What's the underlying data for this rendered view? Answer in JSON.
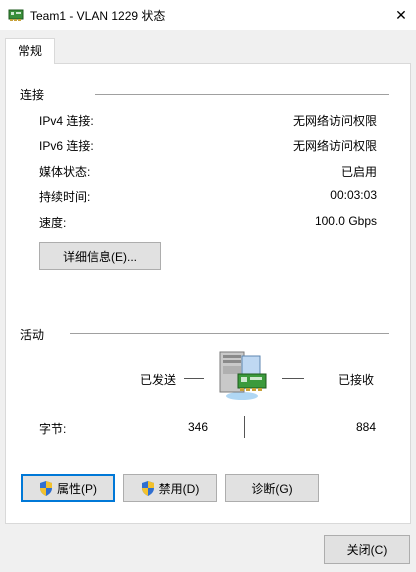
{
  "window": {
    "title": "Team1 - VLAN 1229 状态",
    "close_glyph": "✕"
  },
  "tab": {
    "label": "常规"
  },
  "connection": {
    "label": "连接",
    "rows": [
      {
        "label": "IPv4 连接:",
        "value": "无网络访问权限"
      },
      {
        "label": "IPv6 连接:",
        "value": "无网络访问权限"
      },
      {
        "label": "媒体状态:",
        "value": "已启用"
      },
      {
        "label": "持续时间:",
        "value": "00:03:03"
      },
      {
        "label": "速度:",
        "value": "100.0 Gbps"
      }
    ],
    "details_button": "详细信息(E)..."
  },
  "activity": {
    "label": "活动",
    "sent_label": "已发送",
    "received_label": "已接收",
    "bytes_label": "字节:",
    "bytes_sent": "346",
    "bytes_received": "884"
  },
  "buttons": {
    "properties": "属性(P)",
    "disable": "禁用(D)",
    "diagnose": "诊断(G)",
    "close": "关闭(C)"
  },
  "icons": {
    "window_icon": "network-adapter-icon",
    "computer_icon": "computer-network-icon",
    "shield_icon": "uac-shield-icon"
  },
  "colors": {
    "focus_border": "#0078d7",
    "panel_bg": "#ffffff",
    "window_bg": "#f0f0f0"
  }
}
